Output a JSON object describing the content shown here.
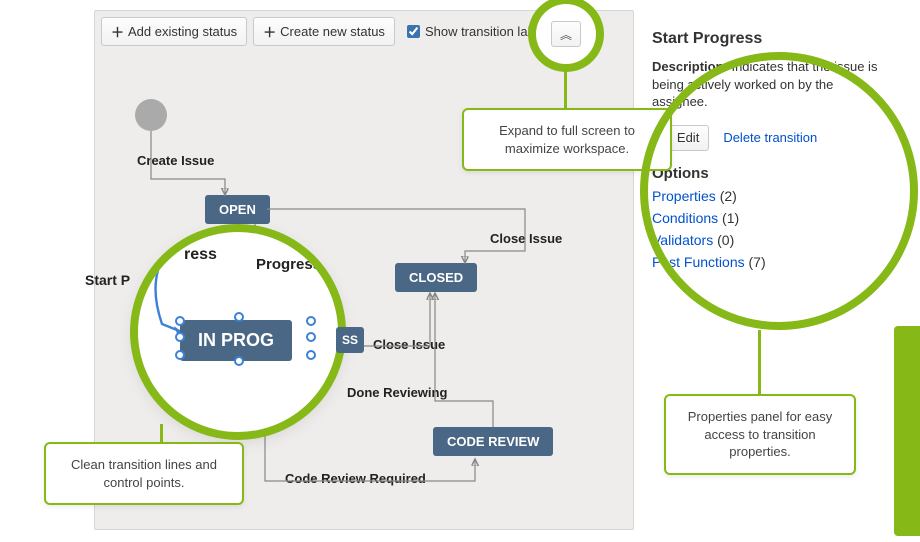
{
  "toolbar": {
    "add_existing_label": "Add existing status",
    "create_new_label": "Create new status",
    "show_labels_text": "Show transition labels"
  },
  "workflow": {
    "start_label": "Create Issue",
    "statuses": {
      "open": "OPEN",
      "in_progress": "IN PROGRESS",
      "closed": "CLOSED",
      "code_review": "CODE REVIEW"
    },
    "transitions": {
      "start_progress": "Start Progress",
      "stop_progress": "Stop Progress",
      "close_issue_top": "Close Issue",
      "close_issue_mid": "Close Issue",
      "done_reviewing": "Done Reviewing",
      "code_review_required": "Code Review Required"
    }
  },
  "props": {
    "title": "Start Progress",
    "desc_label": "Description:",
    "desc_text": "Indicates that the issue is being actively worked on by the assignee.",
    "edit_label": "Edit",
    "delete_label": "Delete transition",
    "options_heading": "Options",
    "options": [
      {
        "name": "Properties",
        "count": 2
      },
      {
        "name": "Conditions",
        "count": 1
      },
      {
        "name": "Validators",
        "count": 0
      },
      {
        "name": "Post Functions",
        "count": 7
      }
    ]
  },
  "zoom": {
    "node_label": "IN PROGRESS",
    "ress_fragment": "ress",
    "progress_fragment": "Progress",
    "start_prefix": "Start P"
  },
  "callouts": {
    "expand": "Expand to full screen to maximize workspace.",
    "clean": "Clean transition lines and control points.",
    "panel": "Properties panel for easy access to transition properties."
  }
}
